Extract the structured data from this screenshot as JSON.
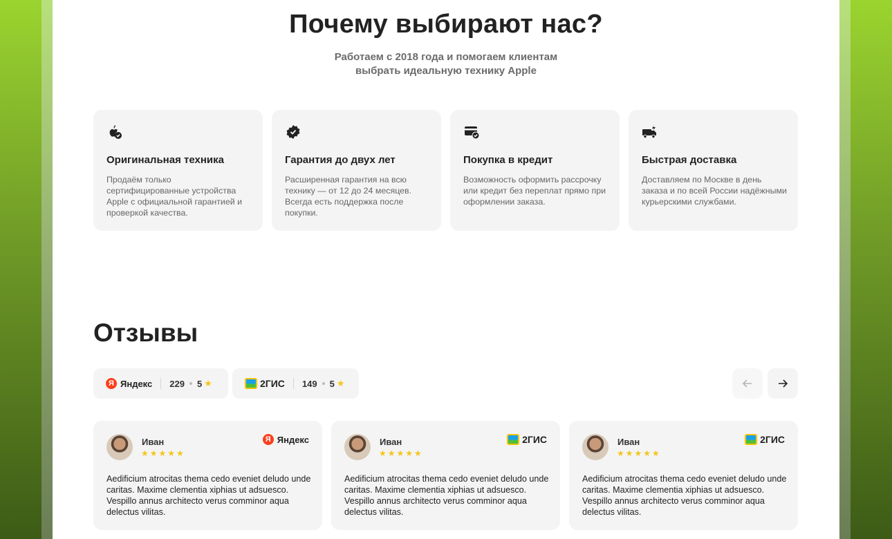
{
  "why": {
    "title": "Почему выбирают нас?",
    "subtitle_line1": "Работаем с 2018 года и помогаем клиентам",
    "subtitle_line2": "выбрать идеальную технику Apple",
    "features": [
      {
        "icon": "apple-check-icon",
        "title": "Оригинальная техника",
        "text": "Продаём только сертифицированные устройства Apple с официальной гарантией и проверкой качества."
      },
      {
        "icon": "verified-badge-icon",
        "title": "Гарантия до двух лет",
        "text": "Расширенная гарантия на всю технику — от 12 до 24 месяцев. Всегда есть поддержка после покупки."
      },
      {
        "icon": "credit-card-check-icon",
        "title": "Покупка в кредит",
        "text": "Возможность оформить рассрочку или кредит без переплат прямо при оформлении заказа."
      },
      {
        "icon": "delivery-truck-icon",
        "title": "Быстрая доставка",
        "text": "Доставляем по Москве в день заказа и по всей России надёжными курьерскими службами."
      }
    ]
  },
  "reviews": {
    "title": "Отзывы",
    "sources": [
      {
        "name": "Яндекс",
        "badge": "Я",
        "count": "229",
        "rating": "5"
      },
      {
        "name": "2ГИС",
        "count": "149",
        "rating": "5"
      }
    ],
    "cards": [
      {
        "name": "Иван",
        "stars": "★★★★★",
        "source": "Яндекс",
        "badge": "Я",
        "text": "Aedificium atrocitas thema cedo eveniet deludo unde caritas. Maxime clementia xiphias ut adsuesco. Vespillo annus architecto verus comminor aqua delectus vilitas."
      },
      {
        "name": "Иван",
        "stars": "★★★★★",
        "source": "2ГИС",
        "text": "Aedificium atrocitas thema cedo eveniet deludo unde caritas. Maxime clementia xiphias ut adsuesco. Vespillo annus architecto verus comminor aqua delectus vilitas."
      },
      {
        "name": "Иван",
        "stars": "★★★★★",
        "source": "2ГИС",
        "text": "Aedificium atrocitas thema cedo eveniet deludo unde caritas. Maxime clementia xiphias ut adsuesco. Vespillo annus architecto verus comminor aqua delectus vilitas."
      }
    ]
  },
  "colors": {
    "accent_green": "#9bd42f",
    "star": "#f5c518",
    "yandex_red": "#fc3f1d",
    "card_bg": "#f4f4f4"
  }
}
